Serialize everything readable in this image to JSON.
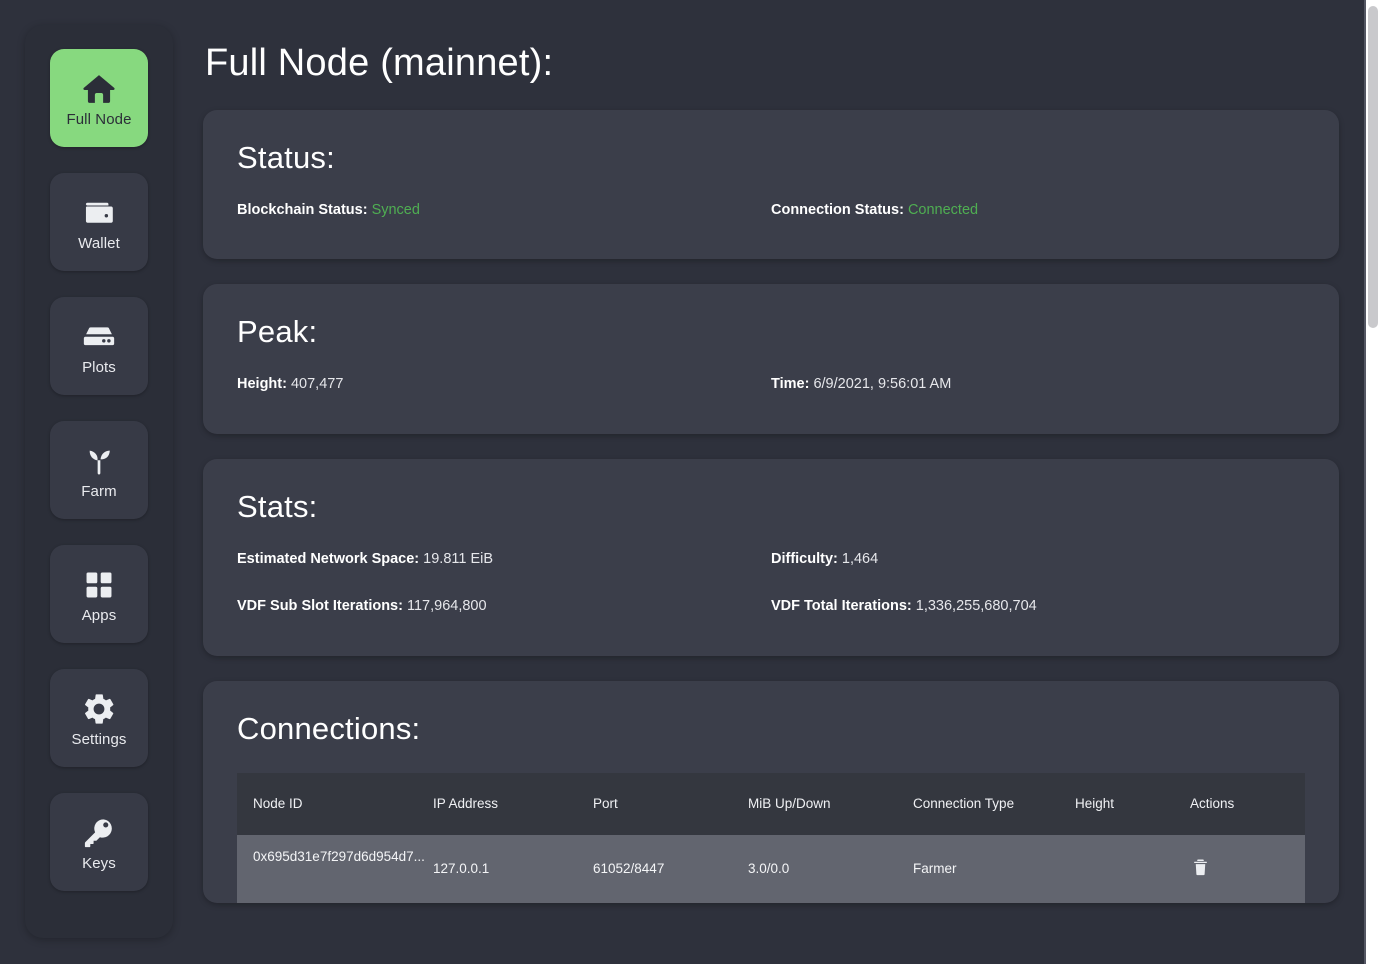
{
  "theme": {
    "page_bg": "#2e313c",
    "card_bg": "#3b3e4a",
    "accent_green": "#87d97f",
    "status_green": "#4fae52",
    "table_header_bg": "#34373f",
    "table_row_bg": "#62656f"
  },
  "sidebar": {
    "items": [
      {
        "label": "Full Node",
        "icon": "home-icon",
        "active": true
      },
      {
        "label": "Wallet",
        "icon": "wallet-icon",
        "active": false
      },
      {
        "label": "Plots",
        "icon": "plots-icon",
        "active": false
      },
      {
        "label": "Farm",
        "icon": "sprout-icon",
        "active": false
      },
      {
        "label": "Apps",
        "icon": "grid-icon",
        "active": false
      },
      {
        "label": "Settings",
        "icon": "gear-icon",
        "active": false
      },
      {
        "label": "Keys",
        "icon": "key-icon",
        "active": false
      }
    ]
  },
  "page": {
    "title": "Full Node (mainnet):"
  },
  "status_card": {
    "title": "Status:",
    "blockchain_status_label": "Blockchain Status:",
    "blockchain_status_value": "Synced",
    "connection_status_label": "Connection Status:",
    "connection_status_value": "Connected"
  },
  "peak_card": {
    "title": "Peak:",
    "height_label": "Height:",
    "height_value": "407,477",
    "time_label": "Time:",
    "time_value": "6/9/2021, 9:56:01 AM"
  },
  "stats_card": {
    "title": "Stats:",
    "network_space_label": "Estimated Network Space:",
    "network_space_value": "19.811 EiB",
    "difficulty_label": "Difficulty:",
    "difficulty_value": "1,464",
    "vdf_sub_slot_label": "VDF Sub Slot Iterations:",
    "vdf_sub_slot_value": "117,964,800",
    "vdf_total_label": "VDF Total Iterations:",
    "vdf_total_value": "1,336,255,680,704"
  },
  "connections_card": {
    "title": "Connections:",
    "columns": [
      "Node ID",
      "IP Address",
      "Port",
      "MiB Up/Down",
      "Connection Type",
      "Height",
      "Actions"
    ],
    "rows": [
      {
        "node_id": "0x695d31e7f297d6d954d7...",
        "ip_address": "127.0.0.1",
        "port": "61052/8447",
        "mib_up_down": "3.0/0.0",
        "connection_type": "Farmer",
        "height": "",
        "action_icon": "trash-icon"
      }
    ]
  }
}
